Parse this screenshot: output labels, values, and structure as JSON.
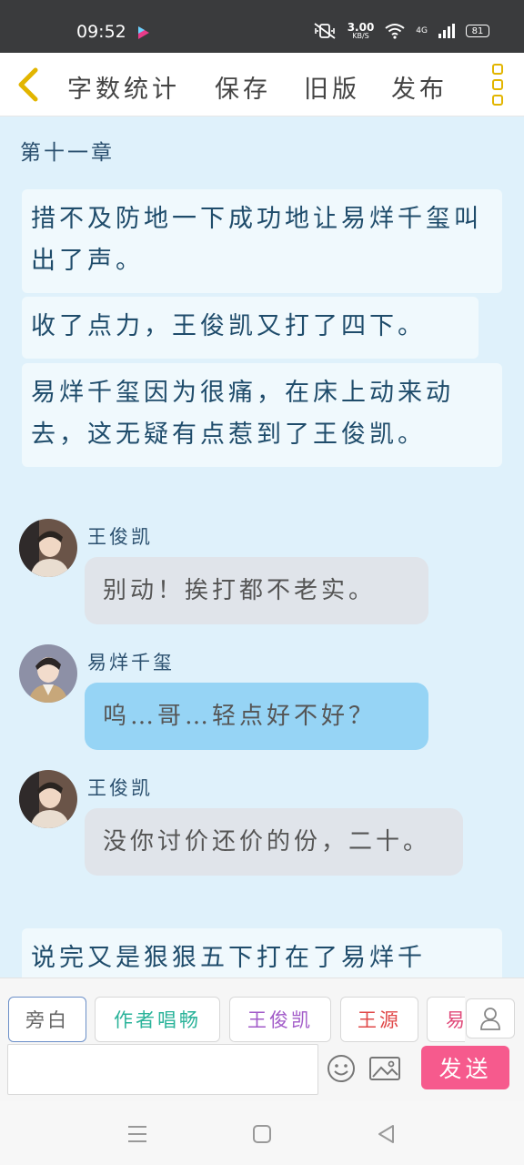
{
  "status": {
    "time": "09:52",
    "speed_value": "3.00",
    "speed_unit": "KB/S",
    "network": "4G",
    "battery": "81"
  },
  "toolbar": {
    "word_count": "字数统计",
    "save": "保存",
    "old_version": "旧版",
    "publish": "发布"
  },
  "chapter_title": "第十一章",
  "narrations": [
    "措不及防地一下成功地让易烊千玺叫出了声。",
    "收了点力，王俊凯又打了四下。",
    "易烊千玺因为很痛，在床上动来动去，这无疑有点惹到了王俊凯。",
    "说完又是狠狠五下打在了易烊千"
  ],
  "messages": [
    {
      "speaker": "王俊凯",
      "text": "别动！挨打都不老实。",
      "style": "gray"
    },
    {
      "speaker": "易烊千玺",
      "text": "呜…哥…轻点好不好？",
      "style": "blue"
    },
    {
      "speaker": "王俊凯",
      "text": "没你讨价还价的份，二十。",
      "style": "gray"
    }
  ],
  "roles": [
    {
      "label": "旁白",
      "color": "#666666"
    },
    {
      "label": "作者唱畅",
      "color": "#2bb39a"
    },
    {
      "label": "王俊凯",
      "color": "#a15ac8"
    },
    {
      "label": "王源",
      "color": "#e04848"
    },
    {
      "label": "易",
      "color": "#e04878"
    }
  ],
  "input": {
    "placeholder": ""
  },
  "send_label": "发送",
  "icons": {
    "back": "chevron-left-icon",
    "menu": "more-vertical-icon",
    "user": "user-icon",
    "emoji": "emoji-icon",
    "image": "image-icon",
    "accent_yellow": "#e2b500",
    "send_pink": "#f65a8d"
  }
}
